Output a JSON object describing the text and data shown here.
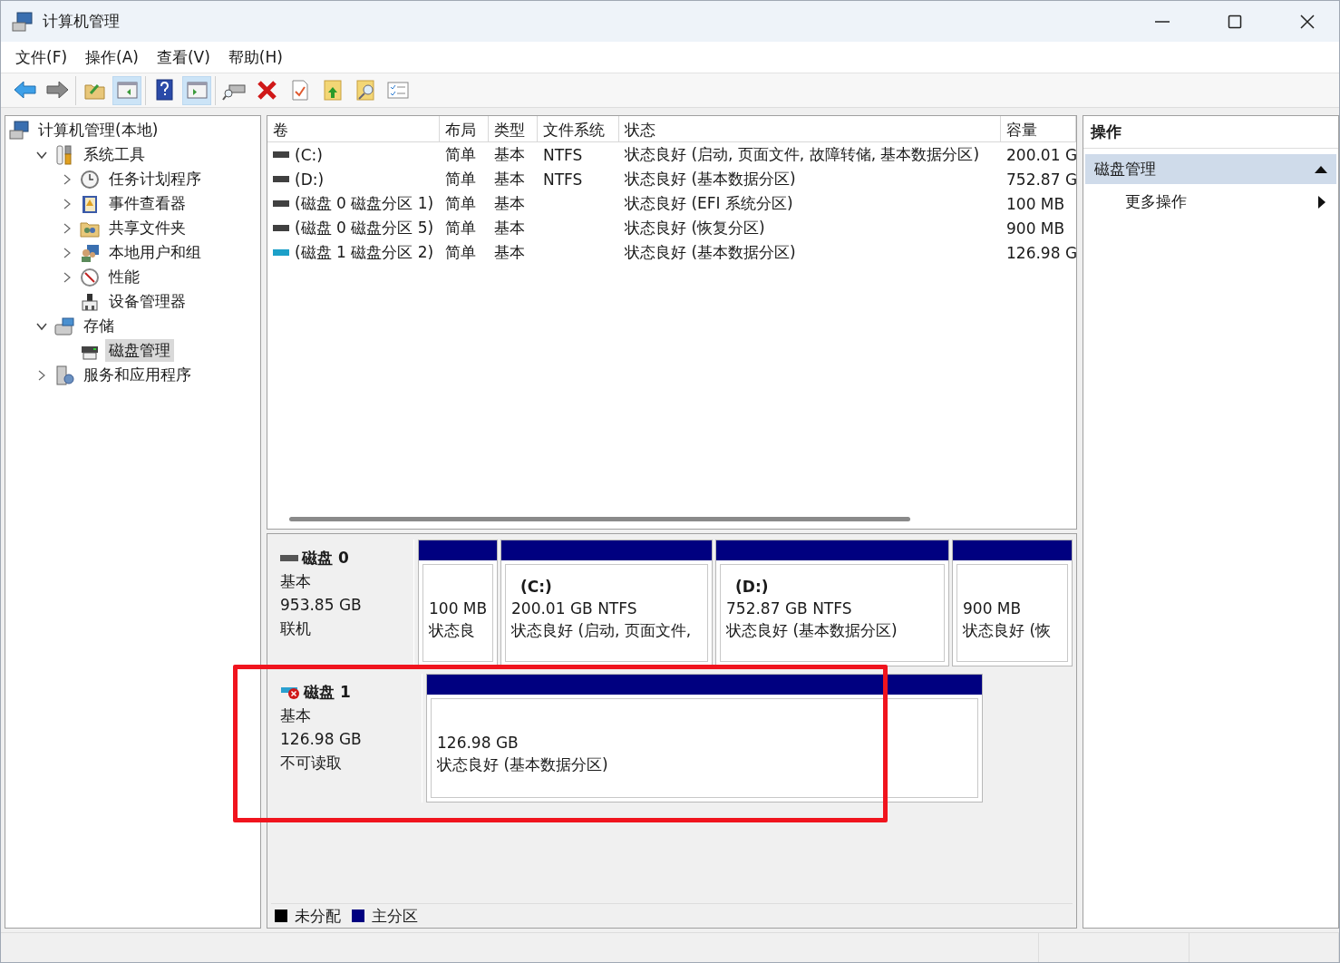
{
  "window": {
    "title": "计算机管理"
  },
  "menu": [
    "文件(F)",
    "操作(A)",
    "查看(V)",
    "帮助(H)"
  ],
  "toolbar": [
    [
      {
        "kind": "back",
        "pressed": false
      },
      {
        "kind": "forward",
        "pressed": false
      }
    ],
    [
      {
        "kind": "up",
        "pressed": false
      },
      {
        "kind": "tree",
        "pressed": true
      }
    ],
    [
      {
        "kind": "help",
        "pressed": false
      },
      {
        "kind": "pane",
        "pressed": true
      }
    ],
    [
      {
        "kind": "connect",
        "pressed": false
      },
      {
        "kind": "delete",
        "pressed": false
      },
      {
        "kind": "check",
        "pressed": false
      },
      {
        "kind": "export",
        "pressed": false
      },
      {
        "kind": "find",
        "pressed": false
      },
      {
        "kind": "properties",
        "pressed": false
      }
    ]
  ],
  "tree": [
    {
      "label": "计算机管理(本地)",
      "selected": false,
      "children": [
        {
          "label": "系统工具",
          "expanded": true,
          "selected": false,
          "children": [
            {
              "label": "任务计划程序",
              "expanded": false,
              "selected": false
            },
            {
              "label": "事件查看器",
              "expanded": false,
              "selected": false
            },
            {
              "label": "共享文件夹",
              "expanded": false,
              "selected": false
            },
            {
              "label": "本地用户和组",
              "expanded": false,
              "selected": false
            },
            {
              "label": "性能",
              "expanded": false,
              "selected": false
            },
            {
              "label": "设备管理器",
              "selected": false
            }
          ]
        },
        {
          "label": "存储",
          "expanded": true,
          "selected": false,
          "children": [
            {
              "label": "磁盘管理",
              "selected": true
            }
          ]
        },
        {
          "label": "服务和应用程序",
          "expanded": false,
          "selected": false
        }
      ]
    }
  ],
  "table": {
    "columns": [
      "卷",
      "布局",
      "类型",
      "文件系统",
      "状态",
      "容量"
    ],
    "rows": [
      {
        "color": "#404040",
        "cells": [
          "(C:)",
          "简单",
          "基本",
          "NTFS",
          "状态良好 (启动, 页面文件, 故障转储, 基本数据分区)",
          "200.01 G"
        ]
      },
      {
        "color": "#404040",
        "cells": [
          "(D:)",
          "简单",
          "基本",
          "NTFS",
          "状态良好 (基本数据分区)",
          "752.87 G"
        ]
      },
      {
        "color": "#404040",
        "cells": [
          "(磁盘 0 磁盘分区 1)",
          "简单",
          "基本",
          "",
          "状态良好 (EFI 系统分区)",
          "100 MB"
        ]
      },
      {
        "color": "#404040",
        "cells": [
          "(磁盘 0 磁盘分区 5)",
          "简单",
          "基本",
          "",
          "状态良好 (恢复分区)",
          "900 MB"
        ]
      },
      {
        "color": "#1ca0c8",
        "cells": [
          "(磁盘 1 磁盘分区 2)",
          "简单",
          "基本",
          "",
          "状态良好 (基本数据分区)",
          "126.98 G"
        ]
      }
    ]
  },
  "disks": [
    {
      "name": "磁盘 0",
      "type": "基本",
      "size": "953.85 GB",
      "status": "联机",
      "error": false,
      "highlighted": false,
      "partitions": [
        {
          "size": "100 MB",
          "status": "状态良"
        },
        {
          "name": "(C:)",
          "size": "200.01 GB NTFS",
          "status": "状态良好 (启动, 页面文件,"
        },
        {
          "name": "(D:)",
          "size": "752.87 GB NTFS",
          "status": "状态良好 (基本数据分区)"
        },
        {
          "size": "900 MB",
          "status": "状态良好 (恢"
        }
      ]
    },
    {
      "name": "磁盘 1",
      "type": "基本",
      "size": "126.98 GB",
      "status": "不可读取",
      "error": true,
      "highlighted": true,
      "partitions": [
        {
          "size": "126.98 GB",
          "status": "状态良好 (基本数据分区)"
        }
      ]
    }
  ],
  "legend": [
    {
      "label": "未分配",
      "color": "#000000"
    },
    {
      "label": "主分区",
      "color": "#000080"
    }
  ],
  "actions": {
    "title": "操作",
    "sections": [
      {
        "label": "磁盘管理",
        "expanded": true,
        "items": [
          "更多操作"
        ]
      }
    ]
  }
}
